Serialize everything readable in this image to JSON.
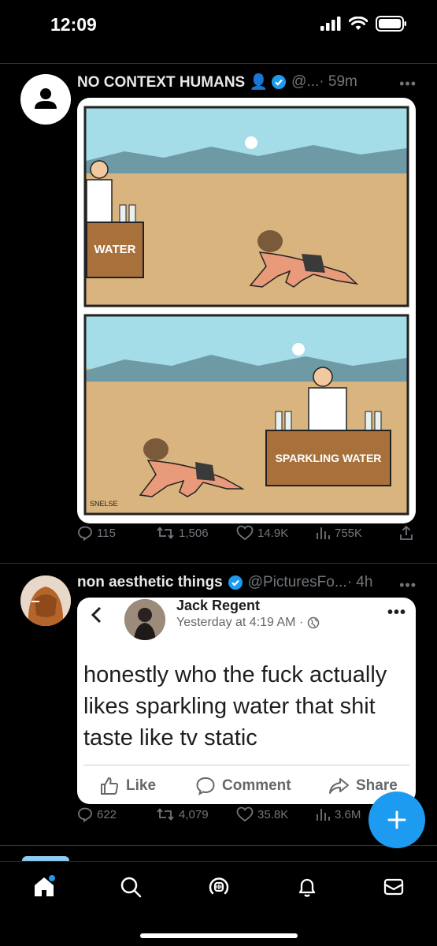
{
  "status_bar": {
    "time": "12:09"
  },
  "tweets": [
    {
      "display_name": "NO CONTEXT HUMANS 👤",
      "handle": "@...",
      "time": "· 59m",
      "comic": {
        "panel1_sign": "WATER",
        "panel2_sign": "SPARKLING WATER",
        "signature": "SNELSE"
      },
      "stats": {
        "replies": "115",
        "retweets": "1,506",
        "likes": "14.9K",
        "views": "755K"
      }
    },
    {
      "display_name": "non aesthetic things",
      "handle": "@PicturesFo...",
      "time": "· 4h",
      "fb_post": {
        "author": "Jack Regent",
        "time": "Yesterday at 4:19 AM ·",
        "text": "honestly who the fuck actually likes sparkling water that shit taste like tv static",
        "like_label": "Like",
        "comment_label": "Comment",
        "share_label": "Share"
      },
      "stats": {
        "replies": "622",
        "retweets": "4,079",
        "likes": "35.8K",
        "views": "3.6M"
      }
    }
  ],
  "icons": [
    "back-icon",
    "verified-icon",
    "reply-icon",
    "retweet-icon",
    "like-icon",
    "views-icon",
    "share-icon",
    "compose-icon",
    "home-icon",
    "search-icon",
    "spaces-icon",
    "bell-icon",
    "mail-icon"
  ],
  "colors": {
    "accent": "#1d9bf0",
    "muted": "#71767b",
    "background": "#000000"
  }
}
